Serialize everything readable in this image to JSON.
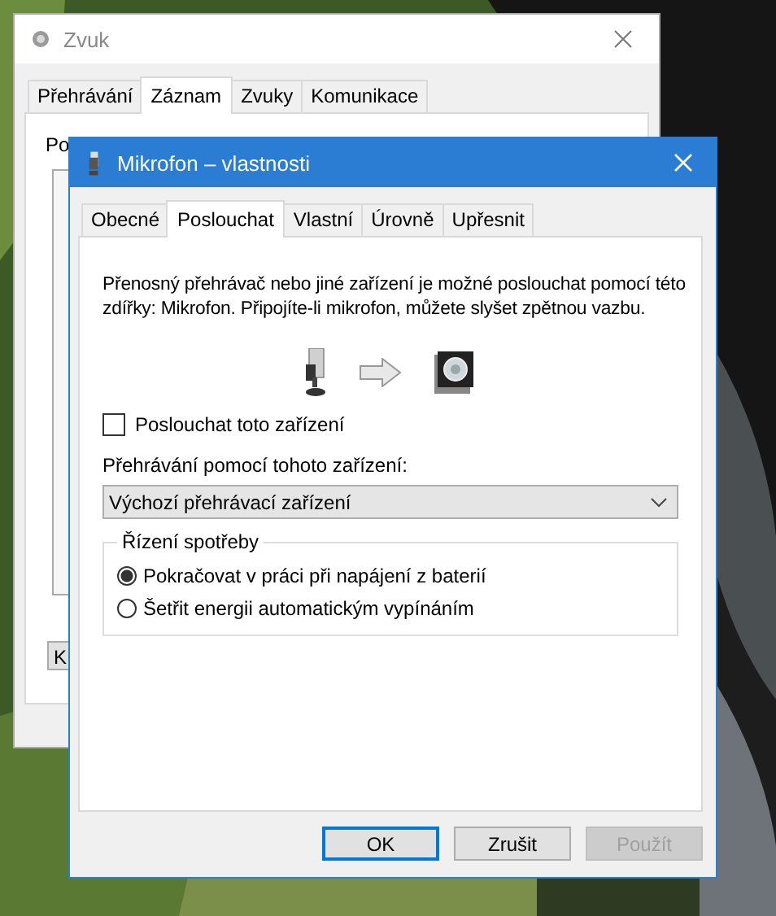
{
  "back_window": {
    "title": "Zvuk",
    "tabs": [
      {
        "label": "Přehrávání",
        "selected": false
      },
      {
        "label": "Záznam",
        "selected": true
      },
      {
        "label": "Zvuky",
        "selected": false
      },
      {
        "label": "Komunikace",
        "selected": false
      }
    ],
    "text_fragment": "Po",
    "button_fragment": "K"
  },
  "dialog": {
    "title": "Mikrofon – vlastnosti",
    "tabs": [
      {
        "label": "Obecné",
        "selected": false
      },
      {
        "label": "Poslouchat",
        "selected": true
      },
      {
        "label": "Vlastní",
        "selected": false
      },
      {
        "label": "Úrovně",
        "selected": false
      },
      {
        "label": "Upřesnit",
        "selected": false
      }
    ],
    "description": "Přenosný přehrávač nebo jiné zařízení je možné poslouchat pomocí této zdířky: Mikrofon. Připojíte-li mikrofon, můžete slyšet zpětnou vazbu.",
    "listen_checkbox": {
      "label": "Poslouchat toto zařízení",
      "checked": false
    },
    "playback": {
      "label": "Přehrávání pomocí tohoto zařízení:",
      "value": "Výchozí přehrávací zařízení"
    },
    "power_group": {
      "title": "Řízení spotřeby",
      "options": [
        {
          "label": "Pokračovat v práci při napájení z baterií",
          "selected": true
        },
        {
          "label": "Šetřit energii automatickým vypínáním",
          "selected": false
        }
      ]
    },
    "buttons": [
      {
        "label": "OK",
        "default": true,
        "disabled": false
      },
      {
        "label": "Zrušit",
        "default": false,
        "disabled": false
      },
      {
        "label": "Použít",
        "default": false,
        "disabled": true
      }
    ]
  }
}
